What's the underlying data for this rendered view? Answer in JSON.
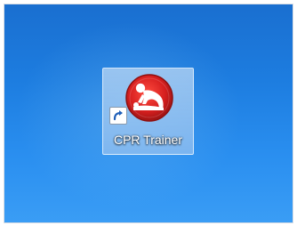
{
  "desktop": {
    "background_color": "#1d7de0",
    "shortcuts": [
      {
        "label": "CPR Trainer",
        "icon": "cpr-trainer-icon",
        "overlay_icon": "shortcut-arrow-icon",
        "selected": true,
        "icon_colors": {
          "ring": "#b31818",
          "fill": "#d81f1f",
          "figure": "#ffffff"
        }
      }
    ]
  }
}
